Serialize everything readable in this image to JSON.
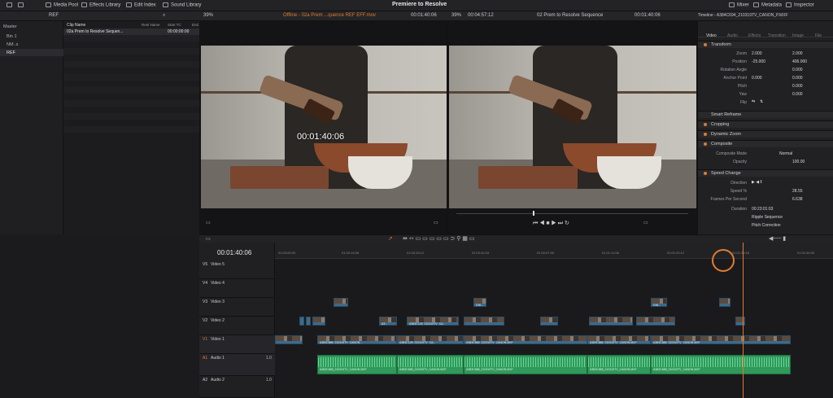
{
  "topbar": {
    "media_pool": "Media Pool",
    "effects_library": "Effects Library",
    "edit_index": "Edit Index",
    "sound_library": "Sound Library",
    "title": "Premiere to Resolve",
    "mixer": "Mixer",
    "metadata": "Metadata",
    "inspector": "Inspector"
  },
  "bar2": {
    "bin_label": "REF",
    "zoom_left": "39%",
    "clip_title": "Offline - 02a Prem ...quence REF EFF.mov",
    "tc_left": "00:01:40:06",
    "zoom_right": "39%",
    "duration_right": "00:04:57:12",
    "sequence_name": "02 Prem to Resolve Sequence",
    "tc_right": "00:01:40:06",
    "timeline_clip": "Timeline - A384C694_210319TV_CANON_P.MXF"
  },
  "bins": {
    "master": "Master",
    "items": [
      "Bin 1",
      "NM..s",
      "REF"
    ]
  },
  "clip_list": {
    "col_clip_name": "Clip Name",
    "col_reel": "Reel Name",
    "col_start": "Start TC",
    "col_end": "End",
    "row_name": "02a Prem to Resolve Sequen...",
    "row_start": "00:00:00:00"
  },
  "viewer": {
    "overlay_tc": "00:01:40:06"
  },
  "inspector": {
    "tabs": [
      "Video",
      "Audio",
      "Effects",
      "Transition",
      "Image",
      "File"
    ],
    "transform": "Transform",
    "zoom_label": "Zoom",
    "zoom_x": "2.000",
    "zoom_y": "2.000",
    "position_label": "Position",
    "pos_x": "-25.000",
    "pos_y": "406.000",
    "rotation_label": "Rotation Angle",
    "rotation_val": "0.000",
    "anchor_label": "Anchor Point",
    "anchor_x": "0.000",
    "anchor_y": "0.000",
    "pitch_label": "Pitch",
    "pitch_val": "0.000",
    "yaw_label": "Yaw",
    "yaw_val": "0.000",
    "flip_label": "Flip",
    "smart_reframe": "Smart Reframe",
    "cropping": "Cropping",
    "dynamic_zoom": "Dynamic Zoom",
    "composite": "Composite",
    "composite_mode_label": "Composite Mode",
    "composite_mode_val": "Normal",
    "opacity_label": "Opacity",
    "opacity_val": "100.00",
    "speed_change": "Speed Change",
    "direction_label": "Direction",
    "speed_label": "Speed %",
    "speed_val": "28.55",
    "fps_label": "Frames Per Second",
    "fps_val": "6.638",
    "duration_label": "Duration",
    "duration_val": "00:23:01:03",
    "ripple": "Ripple Sequence",
    "pitch_correction": "Pitch Correction"
  },
  "timeline": {
    "timecode": "00:01:40:06",
    "ruler": [
      "01:00:00:00",
      "01:00:14:06",
      "01:00:28:12",
      "01:00:42:18",
      "01:00:57:00",
      "01:01:11:06",
      "01:01:25:12",
      "01:01:39:18",
      "01:01:54:00"
    ],
    "tracks": [
      {
        "id": "V5",
        "name": "Video 5"
      },
      {
        "id": "V4",
        "name": "Video 4"
      },
      {
        "id": "V3",
        "name": "Video 3"
      },
      {
        "id": "V2",
        "name": "Video 2"
      },
      {
        "id": "V1",
        "name": "Video 1"
      },
      {
        "id": "A1",
        "name": "Audio 1"
      },
      {
        "id": "A2",
        "name": "Audio 2"
      }
    ],
    "audio_level": "1.0",
    "clip_labels": {
      "a": "A383C688_210319TV_CANON...",
      "b": "A383C128_210319TV_CA...",
      "c": "A383C688_210319TV_CANON.MXF",
      "d": "A383C688_210319TV_CANON.MXF",
      "e": "A383C688_210319TV_CANON.MXF",
      "f": "A383C688_210319TV_CANON.MXF",
      "g": "A383C688_210319TV_CANON.MXF",
      "short": "Gr8...",
      "short2": "A3..."
    }
  },
  "colors": {
    "accent": "#e07b2f",
    "video_clip": "#3b6a8c",
    "audio_clip": "#2f9a5a"
  }
}
